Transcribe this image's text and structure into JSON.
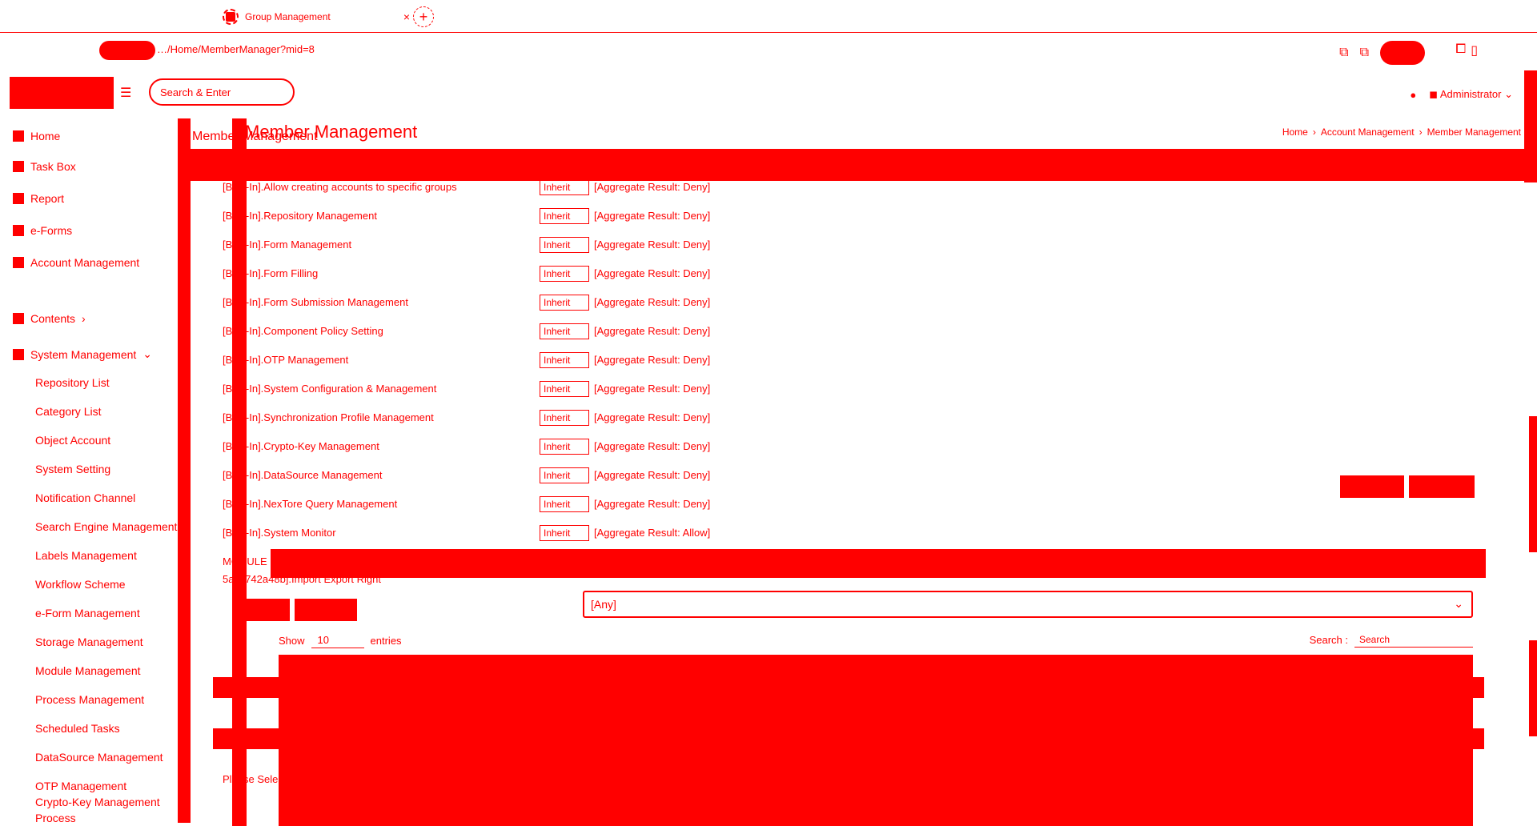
{
  "browser": {
    "tab_title": "Group Management",
    "tab_close": "×",
    "new_tab": "+",
    "url": "…/Home/MemberManager?mid=8"
  },
  "header": {
    "search_placeholder": "Search & Enter",
    "user_label": "Administrator"
  },
  "sidebar": {
    "items": [
      {
        "label": "Home"
      },
      {
        "label": "Task Box"
      },
      {
        "label": "Report"
      },
      {
        "label": "e-Forms"
      },
      {
        "label": "Account Management"
      },
      {
        "label": "Contents"
      },
      {
        "label": "System Management"
      },
      {
        "label": "Repository List"
      },
      {
        "label": "Category List"
      },
      {
        "label": "Object Account"
      },
      {
        "label": "System Setting"
      },
      {
        "label": "Notification Channel"
      },
      {
        "label": "Search Engine Management"
      },
      {
        "label": "Labels Management"
      },
      {
        "label": "Workflow Scheme"
      },
      {
        "label": "e-Form Management"
      },
      {
        "label": "Storage Management"
      },
      {
        "label": "Module Management"
      },
      {
        "label": "Process Management"
      },
      {
        "label": "Scheduled Tasks"
      },
      {
        "label": "DataSource Management"
      },
      {
        "label": "OTP Management"
      },
      {
        "label": "Crypto-Key Management"
      },
      {
        "label": "Process"
      }
    ]
  },
  "main": {
    "title": "Member Management",
    "tab_label": "Member Management",
    "breadcrumb": [
      "Home",
      "Account Management",
      "Member Management"
    ],
    "permissions": [
      {
        "name": "[Built-In].Allow creating accounts to specific groups",
        "value": "Inherit",
        "result": "[Aggregate Result: Deny]"
      },
      {
        "name": "[Built-In].Repository Management",
        "value": "Inherit",
        "result": "[Aggregate Result: Deny]"
      },
      {
        "name": "[Built-In].Form Management",
        "value": "Inherit",
        "result": "[Aggregate Result: Deny]"
      },
      {
        "name": "[Built-In].Form Filling",
        "value": "Inherit",
        "result": "[Aggregate Result: Deny]"
      },
      {
        "name": "[Built-In].Form Submission Management",
        "value": "Inherit",
        "result": "[Aggregate Result: Deny]"
      },
      {
        "name": "[Built-In].Component Policy Setting",
        "value": "Inherit",
        "result": "[Aggregate Result: Deny]"
      },
      {
        "name": "[Built-In].OTP Management",
        "value": "Inherit",
        "result": "[Aggregate Result: Deny]"
      },
      {
        "name": "[Built-In].System Configuration & Management",
        "value": "Inherit",
        "result": "[Aggregate Result: Deny]"
      },
      {
        "name": "[Built-In].Synchronization Profile Management",
        "value": "Inherit",
        "result": "[Aggregate Result: Deny]"
      },
      {
        "name": "[Built-In].Crypto-Key Management",
        "value": "Inherit",
        "result": "[Aggregate Result: Deny]"
      },
      {
        "name": "[Built-In].DataSource Management",
        "value": "Inherit",
        "result": "[Aggregate Result: Deny]"
      },
      {
        "name": "[Built-In].NexTore Query Management",
        "value": "Inherit",
        "result": "[Aggregate Result: Deny]"
      },
      {
        "name": "[Built-In].System Monitor",
        "value": "Inherit",
        "result": "[Aggregate Result: Allow]"
      }
    ],
    "module_label": "MODULE",
    "module_right": "5a8c742a48b].Import Export Right",
    "select_any": "[Any]",
    "show_label": "Show",
    "show_value": "10",
    "entries_label": "entries",
    "search_label": "Search :",
    "search_placeholder": "Search",
    "please_select": "Please Select"
  }
}
